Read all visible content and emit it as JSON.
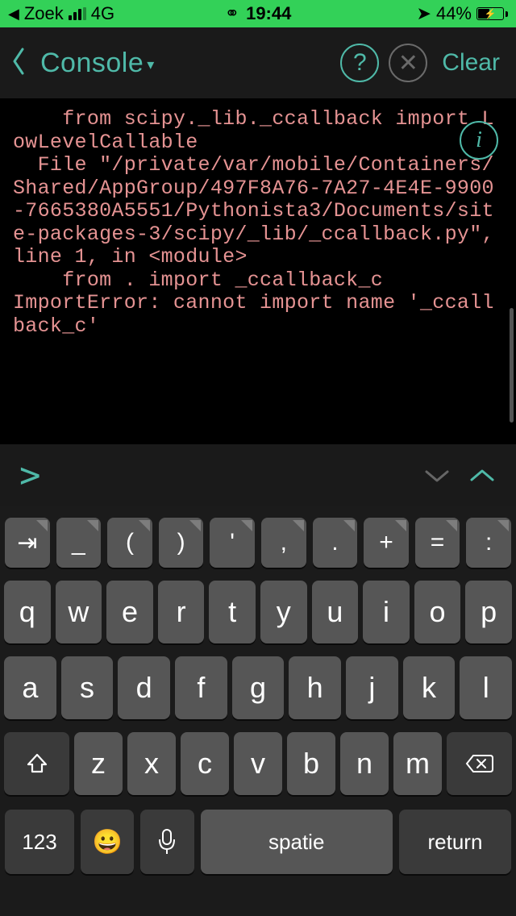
{
  "statusbar": {
    "back_app": "Zoek",
    "network": "4G",
    "time": "19:44",
    "battery_pct": "44%"
  },
  "header": {
    "title": "Console",
    "clear": "Clear",
    "help_symbol": "?",
    "close_symbol": "✕"
  },
  "console": {
    "output": "    from scipy._lib._ccallback import LowLevelCallable\n  File \"/private/var/mobile/Containers/Shared/AppGroup/497F8A76-7A27-4E4E-9900-7665380A5551/Pythonista3/Documents/site-packages-3/scipy/_lib/_ccallback.py\", line 1, in <module>\n    from . import _ccallback_c\nImportError: cannot import name '_ccallback_c'",
    "info_symbol": "i",
    "prompt_symbol": ">"
  },
  "keyboard": {
    "sym_row": [
      "⇥",
      "_",
      "(",
      ")",
      "'",
      ",",
      ".",
      "+",
      "=",
      ":"
    ],
    "row1": [
      "q",
      "w",
      "e",
      "r",
      "t",
      "y",
      "u",
      "i",
      "o",
      "p"
    ],
    "row2": [
      "a",
      "s",
      "d",
      "f",
      "g",
      "h",
      "j",
      "k",
      "l"
    ],
    "row3": [
      "z",
      "x",
      "c",
      "v",
      "b",
      "n",
      "m"
    ],
    "k123": "123",
    "space": "spatie",
    "return": "return"
  }
}
